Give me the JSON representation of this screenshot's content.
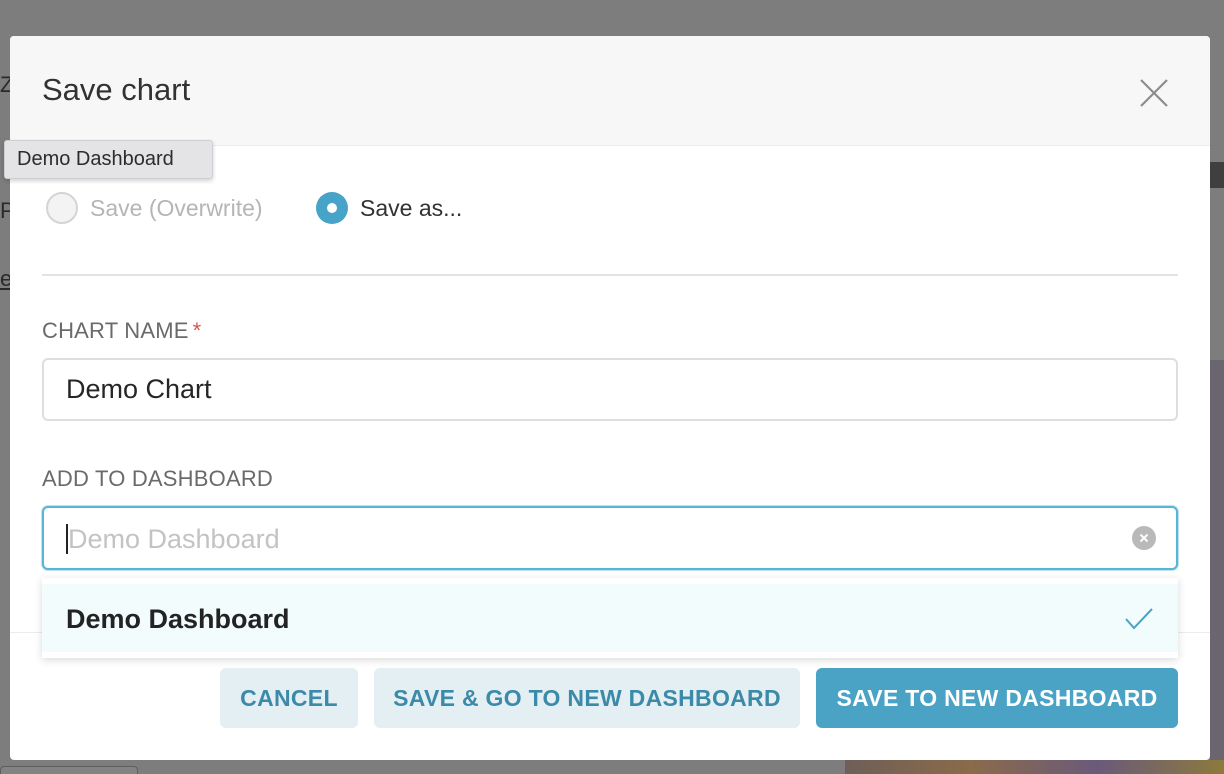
{
  "background": {
    "partial_letters": [
      "Z",
      "P",
      "e"
    ]
  },
  "modal": {
    "title": "Save chart",
    "close_icon": "close-icon"
  },
  "tooltip": {
    "text": "Demo Dashboard"
  },
  "save_mode": {
    "options": [
      {
        "label": "Save (Overwrite)",
        "checked": false,
        "disabled": true
      },
      {
        "label": "Save as...",
        "checked": true,
        "disabled": false
      }
    ]
  },
  "chart_name": {
    "label": "CHART NAME",
    "required_marker": "*",
    "value": "Demo Chart"
  },
  "dashboard": {
    "label": "ADD TO DASHBOARD",
    "placeholder": "Demo Dashboard",
    "clear_icon": "clear-icon",
    "options": [
      {
        "label": "Demo Dashboard",
        "selected": true,
        "icon": "check-icon"
      }
    ]
  },
  "buttons": {
    "cancel": "CANCEL",
    "save_and_go": "SAVE & GO TO NEW DASHBOARD",
    "save_to_new": "SAVE TO NEW DASHBOARD"
  },
  "colors": {
    "accent": "#4aa3c5",
    "focus_border": "#57b5d5",
    "required": "#d9534f",
    "option_highlight": "#f2fcfd"
  }
}
